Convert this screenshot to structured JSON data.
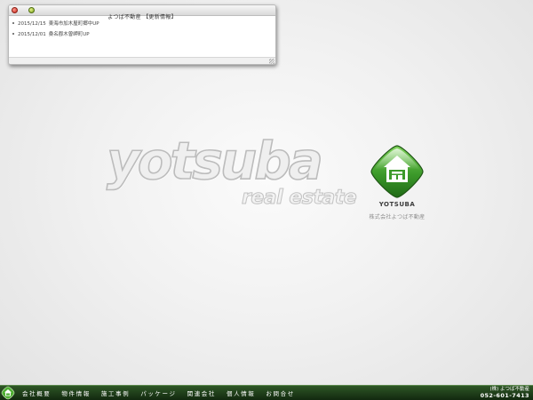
{
  "news_window": {
    "title": "よつば不動産 【更新情報】",
    "items": [
      {
        "date": "2015/12/15",
        "text": "東海市加木屋町郷中UP"
      },
      {
        "date": "2015/12/01",
        "text": "桑名郡木曽岬町UP"
      }
    ]
  },
  "logo": {
    "word": "yotsuba",
    "tagline": "real estate",
    "emblem_brand": "YOTSUBA",
    "company": "株式会社よつば不動産"
  },
  "footer": {
    "nav": [
      {
        "label": "会社概要"
      },
      {
        "label": "物件情報"
      },
      {
        "label": "施工事例"
      },
      {
        "label": "パッケージ"
      },
      {
        "label": "関連会社"
      },
      {
        "label": "個人情報"
      },
      {
        "label": "お問合せ"
      }
    ],
    "contact_name": "(株) よつば不動産",
    "contact_phone": "052-601-7413"
  },
  "colors": {
    "footer_green": "#1f3f1a",
    "emblem_green": "#3f9a2c"
  },
  "icons": {
    "close": "close-button-icon",
    "minimize": "minimize-button-icon",
    "emblem": "yotsuba-house-emblem-icon",
    "footer_logo": "yotsuba-small-emblem-icon"
  }
}
